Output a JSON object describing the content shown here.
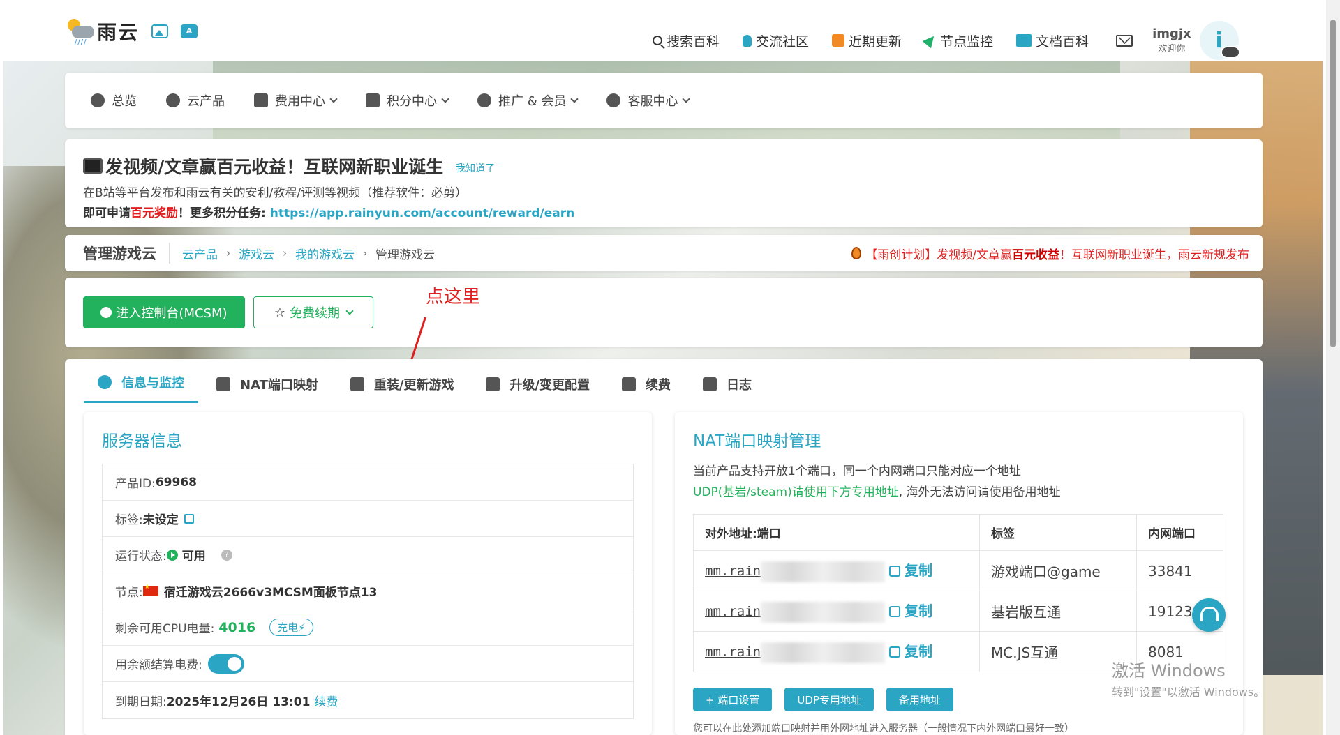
{
  "topbar": {
    "brand": "雨云",
    "nav": [
      "搜索百科",
      "交流社区",
      "近期更新",
      "节点监控",
      "文档百科"
    ],
    "user": {
      "name": "imgjx",
      "welcome": "欢迎你",
      "avatar_letter": "i"
    }
  },
  "menu": [
    {
      "label": "总览",
      "icon": "dashboard-icon",
      "has_dropdown": false
    },
    {
      "label": "云产品",
      "icon": "cubes-icon",
      "has_dropdown": false
    },
    {
      "label": "费用中心",
      "icon": "money-icon",
      "has_dropdown": true
    },
    {
      "label": "积分中心",
      "icon": "gift-icon",
      "has_dropdown": true
    },
    {
      "label": "推广 & 会员",
      "icon": "users-icon",
      "has_dropdown": true
    },
    {
      "label": "客服中心",
      "icon": "headset-icon",
      "has_dropdown": true
    }
  ],
  "notice": {
    "headline": "发视频/文章赢百元收益！互联网新职业诞生",
    "ack": "我知道了",
    "line1": "在B站等平台发布和雨云有关的安利/教程/评测等视频（推荐软件：必剪）",
    "line2_pre": "即可申请",
    "line2_red": "百元奖励",
    "line2_mid": "！更多积分任务: ",
    "line2_link": "https://app.rainyun.com/account/reward/earn"
  },
  "page": {
    "title": "管理游戏云",
    "breadcrumbs": [
      "云产品",
      "游戏云",
      "我的游戏云",
      "管理游戏云"
    ],
    "promo_a": "【雨创计划】发视频/文章赢",
    "promo_b": "百元收益",
    "promo_c": "！互联网新职业诞生，雨云新规发布"
  },
  "actions": {
    "console": "进入控制台(MCSM)",
    "renew": "免费续期",
    "annotation": "点这里"
  },
  "tabs": [
    "信息与监控",
    "NAT端口映射",
    "重装/更新游戏",
    "升级/变更配置",
    "续费",
    "日志"
  ],
  "server_info": {
    "title": "服务器信息",
    "product_id_label": "产品ID: ",
    "product_id": "69968",
    "tag_label": "标签: ",
    "tag": "未设定",
    "status_label": "运行状态: ",
    "status": "可用",
    "node_label": "节点: ",
    "node": "宿迁游戏云2666v3MCSM面板节点13",
    "cpu_label": "剩余可用CPU电量: ",
    "cpu": "4016",
    "charge": "充电⚡",
    "balance_label": "用余额结算电费: ",
    "balance_enabled": true,
    "expire_label": "到期日期: ",
    "expire": "2025年12月26日 13:01",
    "expire_renew": "续费"
  },
  "nat": {
    "title": "NAT端口映射管理",
    "desc1": "当前产品支持开放1个端口，同一个内网端口只能对应一个地址",
    "desc2_green": "UDP(基岩/steam)请使用下方专用地址",
    "desc2_rest": ", 海外无法访问请使用备用地址",
    "columns": [
      "对外地址:端口",
      "标签",
      "内网端口"
    ],
    "copy": "复制",
    "rows": [
      {
        "addr": "mm.rain",
        "tag": "游戏端口@game",
        "port": "33841"
      },
      {
        "addr": "mm.rain",
        "tag": "基岩版互通",
        "port": "19123"
      },
      {
        "addr": "mm.rain",
        "tag": "MC.JS互通",
        "port": "8081"
      }
    ],
    "buttons": [
      "+ 端口设置",
      "UDP专用地址",
      "备用地址"
    ],
    "note": "您可以在此处添加端口映射并用外网地址进入服务器（一般情况下内外网端口最好一致）"
  },
  "windows": {
    "line1": "激活 Windows",
    "line2": "转到\"设置\"以激活 Windows。"
  }
}
